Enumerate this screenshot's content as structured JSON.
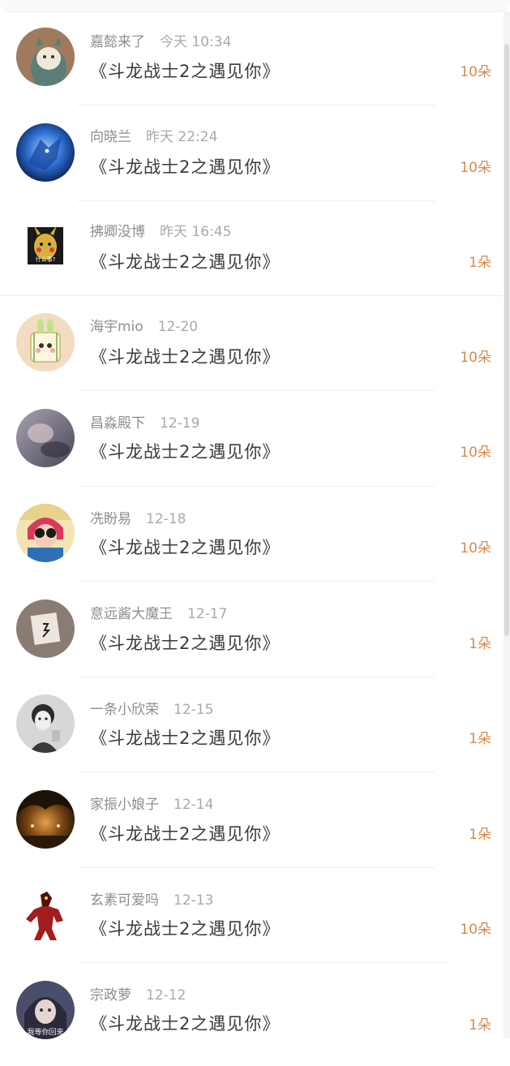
{
  "items": [
    {
      "name": "嘉懿来了",
      "time": "今天 10:34",
      "title": "《斗龙战士2之遇见你》",
      "gift": "10朵",
      "avatar_icon": "cartoon-hooded-avatar"
    },
    {
      "name": "向晓兰",
      "time": "昨天 22:24",
      "title": "《斗龙战士2之遇见你》",
      "gift": "10朵",
      "avatar_icon": "blue-wolf-avatar"
    },
    {
      "name": "拂卿没博",
      "time": "昨天 16:45",
      "title": "《斗龙战士2之遇见你》",
      "gift": "1朵",
      "avatar_icon": "pikachu-meme-avatar",
      "avatar_caption": "什么事?"
    },
    {
      "name": "海宇mio",
      "time": "12-20",
      "title": "《斗龙战士2之遇见你》",
      "gift": "10朵",
      "avatar_icon": "cartoon-bunny-avatar"
    },
    {
      "name": "昌淼殿下",
      "time": "12-19",
      "title": "《斗龙战士2之遇见你》",
      "gift": "10朵",
      "avatar_icon": "blurry-photo-avatar"
    },
    {
      "name": "冼盼易",
      "time": "12-18",
      "title": "《斗龙战士2之遇见你》",
      "gift": "10朵",
      "avatar_icon": "girl-sunglasses-avatar"
    },
    {
      "name": "意远酱大魔王",
      "time": "12-17",
      "title": "《斗龙战士2之遇见你》",
      "gift": "1朵",
      "avatar_icon": "note-paper-avatar"
    },
    {
      "name": "一条小欣荣",
      "time": "12-15",
      "title": "《斗龙战士2之遇见你》",
      "gift": "1朵",
      "avatar_icon": "bw-girl-avatar"
    },
    {
      "name": "家振小娘子",
      "time": "12-14",
      "title": "《斗龙战士2之遇见你》",
      "gift": "1朵",
      "avatar_icon": "night-street-avatar"
    },
    {
      "name": "玄素可爱吗",
      "time": "12-13",
      "title": "《斗龙战士2之遇见你》",
      "gift": "10朵",
      "avatar_icon": "red-robot-avatar"
    },
    {
      "name": "宗政萝",
      "time": "12-12",
      "title": "《斗龙战士2之遇见你》",
      "gift": "1朵",
      "avatar_icon": "anime-girl-avatar",
      "avatar_caption": "我等你回来"
    }
  ],
  "colors": {
    "name": "#8e8e8e",
    "time": "#a9a9a9",
    "title": "#3a3a3a",
    "gift": "#d48a4e",
    "divider": "#eeeeee"
  }
}
